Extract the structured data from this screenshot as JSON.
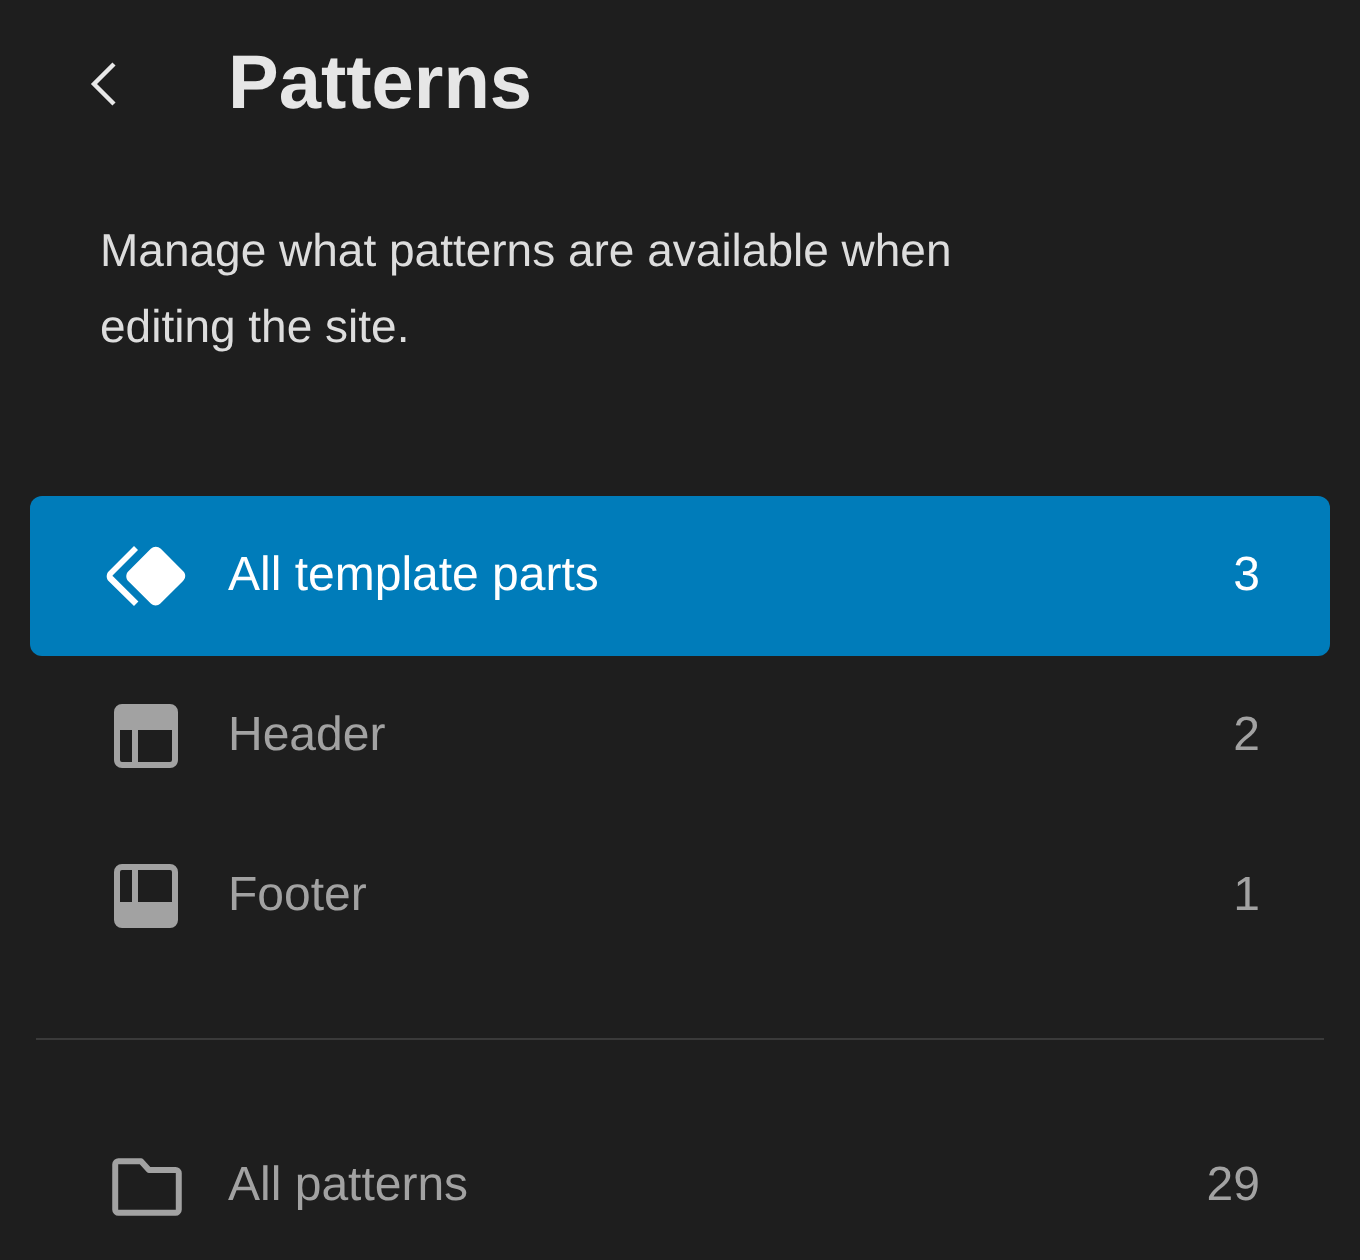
{
  "header": {
    "title": "Patterns"
  },
  "description": "Manage what patterns are available when editing the site.",
  "template_parts": [
    {
      "kind": "all",
      "label": "All template parts",
      "count": "3",
      "selected": true
    },
    {
      "kind": "header",
      "label": "Header",
      "count": "2",
      "selected": false
    },
    {
      "kind": "footer",
      "label": "Footer",
      "count": "1",
      "selected": false
    }
  ],
  "patterns": [
    {
      "kind": "folder",
      "label": "All patterns",
      "count": "29",
      "selected": false
    }
  ]
}
